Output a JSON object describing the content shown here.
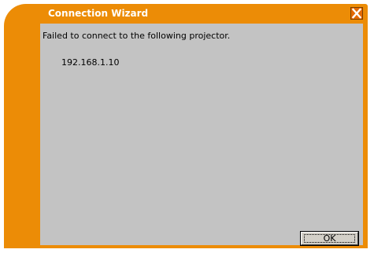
{
  "window": {
    "title": "Connection Wizard"
  },
  "title_bar": {
    "close_icon": "close-x-icon"
  },
  "dialog": {
    "message": "Failed to connect to the following projector.",
    "ip_address": "192.168.1.10",
    "ok_label": "OK"
  },
  "colors": {
    "frame_orange": "#ec8c06",
    "client_gray": "#c3c3c3",
    "title_text": "#ffffff"
  }
}
